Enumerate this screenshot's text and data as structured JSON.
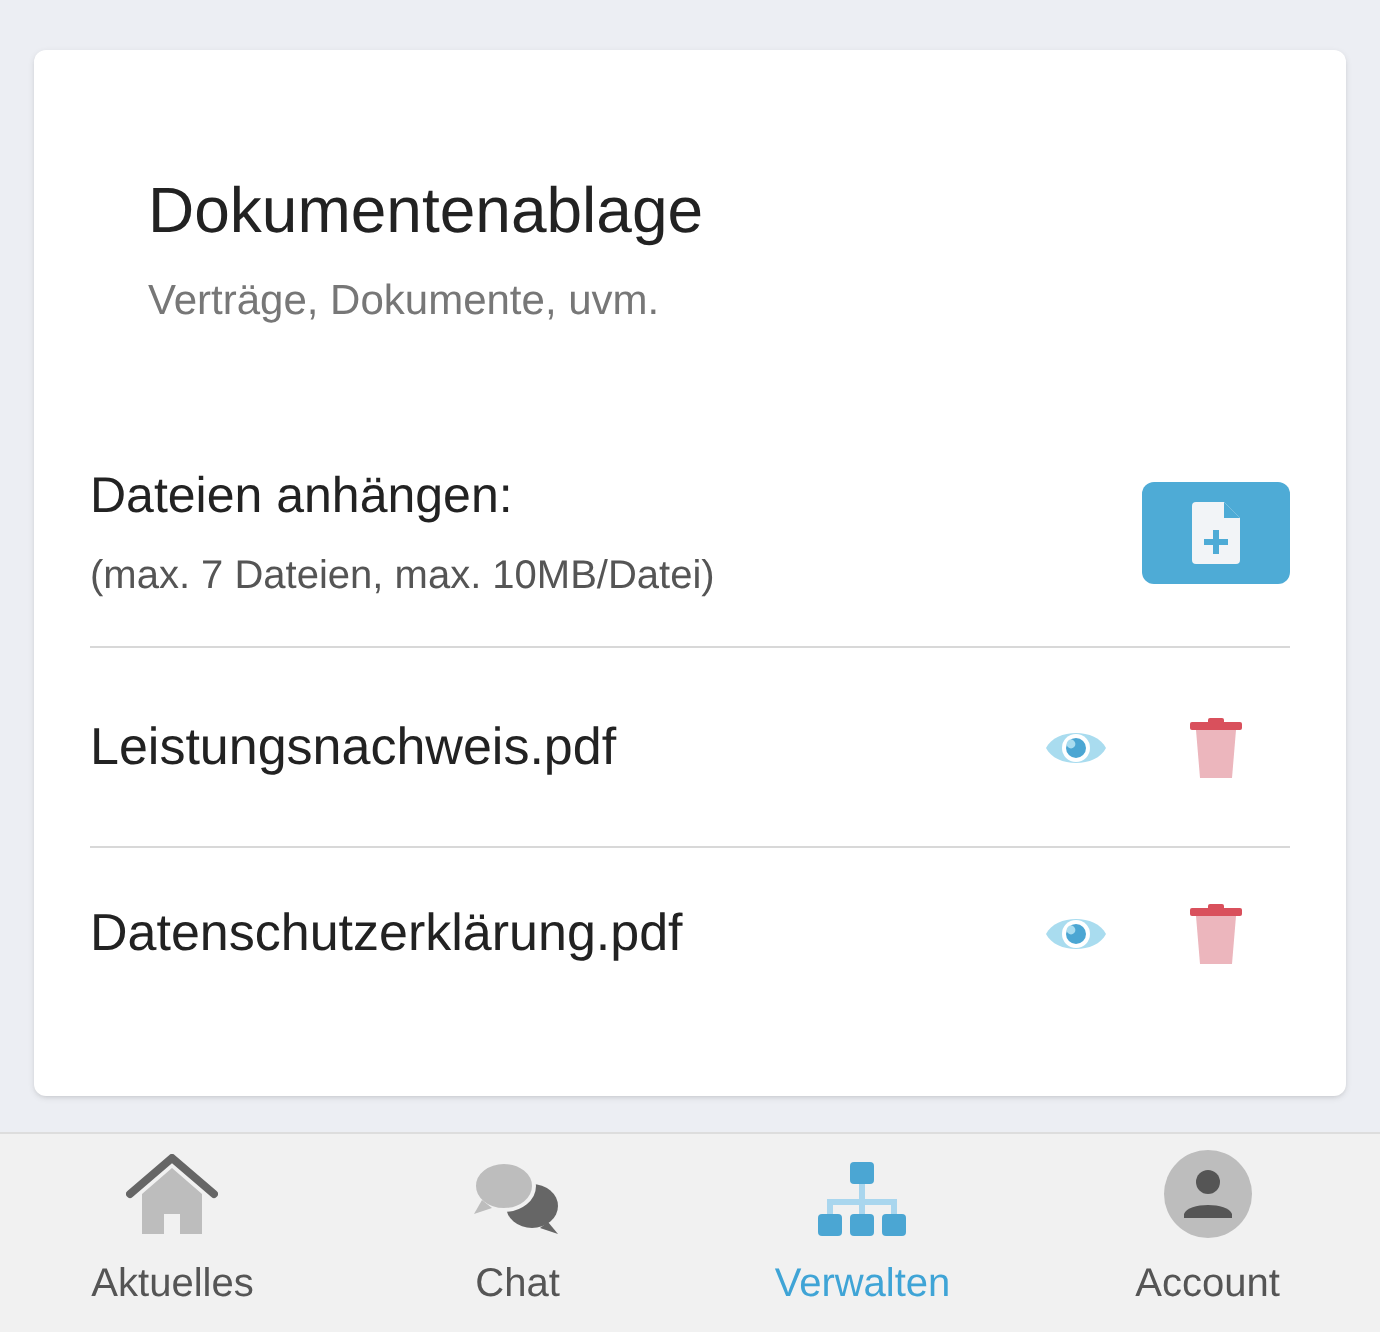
{
  "card": {
    "title": "Dokumentenablage",
    "subtitle": "Verträge, Dokumente, uvm."
  },
  "attach": {
    "label": "Dateien anhängen:",
    "hint": "(max. 7 Dateien, max. 10MB/Datei)"
  },
  "files": [
    {
      "name": "Leistungsnachweis.pdf"
    },
    {
      "name": "Datenschutzerklärung.pdf"
    }
  ],
  "tabs": [
    {
      "label": "Aktuelles",
      "kind": "home",
      "selected": false
    },
    {
      "label": "Chat",
      "kind": "chat",
      "selected": false
    },
    {
      "label": "Verwalten",
      "kind": "org",
      "selected": true
    },
    {
      "label": "Account",
      "kind": "account",
      "selected": false
    }
  ]
}
